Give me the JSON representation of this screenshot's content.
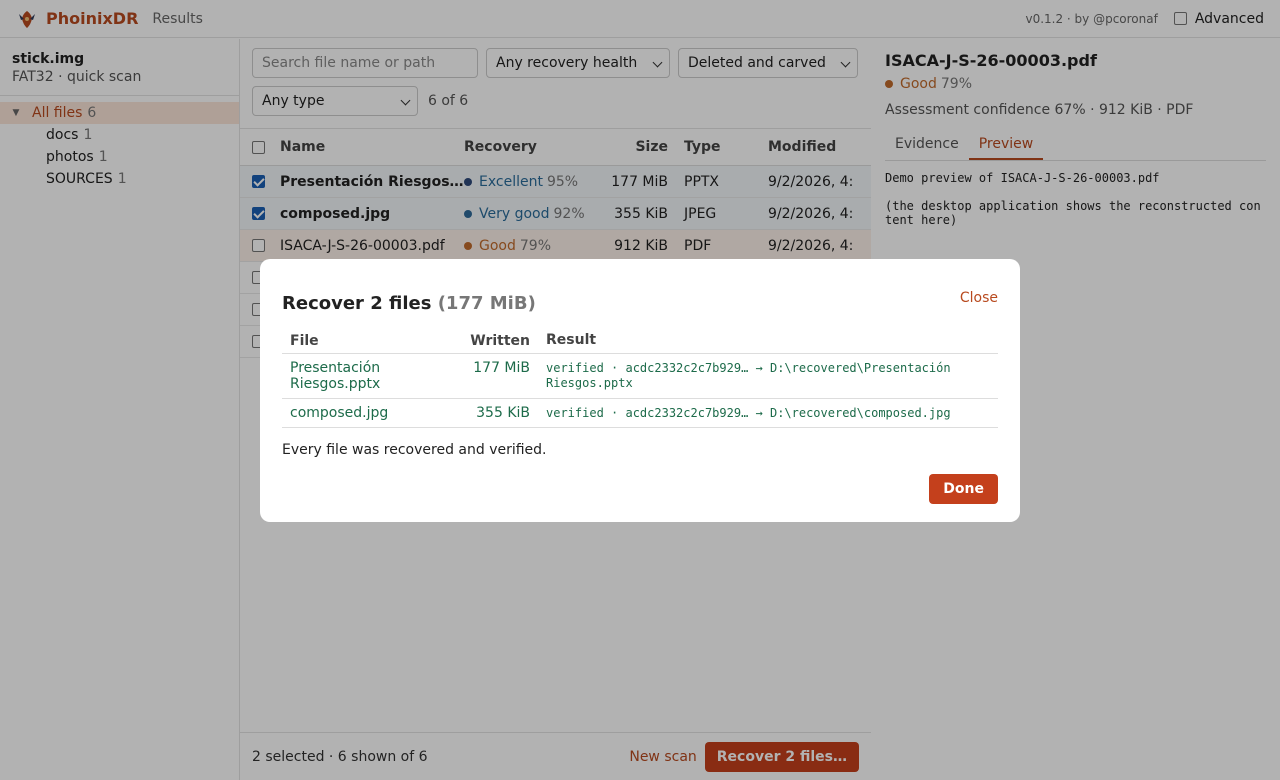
{
  "app": {
    "brand": "PhoinixDR",
    "nav_results": "Results",
    "version": "v0.1.2 · by @pcoronaf",
    "advanced_label": "Advanced"
  },
  "sidebar": {
    "source_name": "stick.img",
    "source_info": "FAT32 · quick scan",
    "tree": [
      {
        "label": "All files",
        "count": "6"
      },
      {
        "label": "docs",
        "count": "1"
      },
      {
        "label": "photos",
        "count": "1"
      },
      {
        "label": "SOURCES",
        "count": "1"
      }
    ]
  },
  "filters": {
    "search_placeholder": "Search file name or path",
    "health": "Any recovery health",
    "mode": "Deleted and carved",
    "type": "Any type",
    "count": "6 of 6"
  },
  "table": {
    "headers": {
      "name": "Name",
      "recovery": "Recovery",
      "size": "Size",
      "type": "Type",
      "modified": "Modified"
    },
    "rows": [
      {
        "name": "Presentación Riesgos.pptx",
        "health": "Excellent",
        "pct": "95%",
        "size": "177 MiB",
        "type": "PPTX",
        "modified": "9/2/2026, 4:",
        "color": "#2a6c9a"
      },
      {
        "name": "composed.jpg",
        "health": "Very good",
        "pct": "92%",
        "size": "355 KiB",
        "type": "JPEG",
        "modified": "9/2/2026, 4:",
        "color": "#2a6c9a"
      },
      {
        "name": "ISACA-J-S-26-00003.pdf",
        "health": "Good",
        "pct": "79%",
        "size": "912 KiB",
        "type": "PDF",
        "modified": "9/2/2026, 4:",
        "color": "#c06a2b"
      }
    ]
  },
  "footer": {
    "status": "2 selected · 6 shown of 6",
    "new_scan": "New scan",
    "recover": "Recover 2 files…"
  },
  "detail": {
    "title": "ISACA-J-S-26-00003.pdf",
    "health": "Good",
    "health_pct": "79%",
    "meta": "Assessment confidence 67% · 912 KiB · PDF",
    "tab_evidence": "Evidence",
    "tab_preview": "Preview",
    "preview_text": "Demo preview of ISACA-J-S-26-00003.pdf\n\n(the desktop application shows the reconstructed content here)"
  },
  "modal": {
    "title": "Recover 2 files",
    "size": "(177 MiB)",
    "close": "Close",
    "headers": {
      "file": "File",
      "written": "Written",
      "result": "Result"
    },
    "rows": [
      {
        "file": "Presentación Riesgos.pptx",
        "written": "177 MiB",
        "result": "verified · acdc2332c2c7b929… → D:\\recovered\\Presentación Riesgos.pptx"
      },
      {
        "file": "composed.jpg",
        "written": "355 KiB",
        "result": "verified · acdc2332c2c7b929… → D:\\recovered\\composed.jpg"
      }
    ],
    "message": "Every file was recovered and verified.",
    "done": "Done"
  },
  "colors": {
    "accent": "#c4401c",
    "success": "#1d6b4a",
    "good": "#c06a2b",
    "excellent": "#2a6c9a"
  }
}
